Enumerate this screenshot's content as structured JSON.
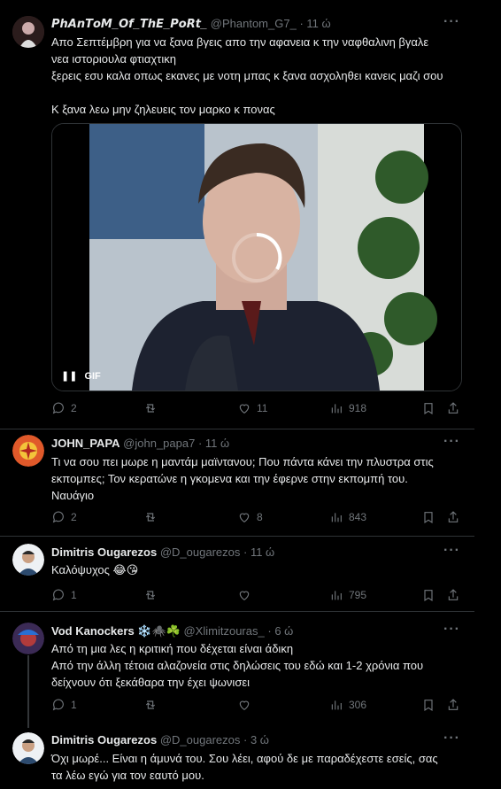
{
  "tweets": [
    {
      "name": "𝙋𝙝𝘼𝙣𝙏𝙤𝙈_𝙊𝙛_𝙏𝙝𝙀_𝙋𝙤𝙍𝙩_",
      "handle": "@Phantom_G7_",
      "time": "11 ώ",
      "lines": [
        "Απο Σεπτέμβρη για να ξανα βγεις απο την αφανεια κ την ναφθαλινη βγαλε",
        "νεα ιστοριουλα φτιαχτικη",
        "ξερεις εσυ καλα οπως εκανες με νοτη μπας κ ξανα ασχοληθει κανεις μαζι σου",
        "",
        "Κ ξανα λεω μην ζηλευεις τον μαρκο κ πονας"
      ],
      "media_badge": "GIF",
      "replies": "2",
      "likes": "11",
      "views": "918"
    },
    {
      "name": "JOHN_PAPA",
      "handle": "@john_papa7",
      "time": "11 ώ",
      "lines": [
        "Τι να σου πει μωρε η μαντάμ μαϊντανου; Που πάντα κάνει την πλυστρα στις",
        "εκπομπες; Τον κερατώνε η γκομενα και την έφερνε στην εκπομπή του.",
        "Ναυάγιο"
      ],
      "replies": "2",
      "likes": "8",
      "views": "843"
    },
    {
      "name": "Dimitris Ougarezos",
      "handle": "@D_ougarezos",
      "time": "11 ώ",
      "lines": [
        "Καλόψυχος 😂😘"
      ],
      "replies": "1",
      "likes": "",
      "views": "795"
    },
    {
      "name": "Vod Kanockers ❄️🕷️☘️",
      "handle": "@Xlimitzouras_",
      "time": "6 ώ",
      "lines": [
        "Από τη μια λες η κριτική που δέχεται είναι άδικη",
        "Από την άλλη τέτοια αλαζονεία στις δηλώσεις του εδώ και 1-2 χρόνια που",
        "δείχνουν ότι ξεκάθαρα την έχει ψωνισει"
      ],
      "replies": "1",
      "likes": "",
      "views": "306"
    },
    {
      "name": "Dimitris Ougarezos",
      "handle": "@D_ougarezos",
      "time": "3 ώ",
      "lines": [
        "Όχι μωρέ... Είναι η άμυνά του. Σου λέει, αφού δε με παραδέχεστε εσείς, σας",
        "τα λέω εγώ για τον εαυτό μου."
      ]
    }
  ],
  "more_label": "···",
  "separator": "·"
}
